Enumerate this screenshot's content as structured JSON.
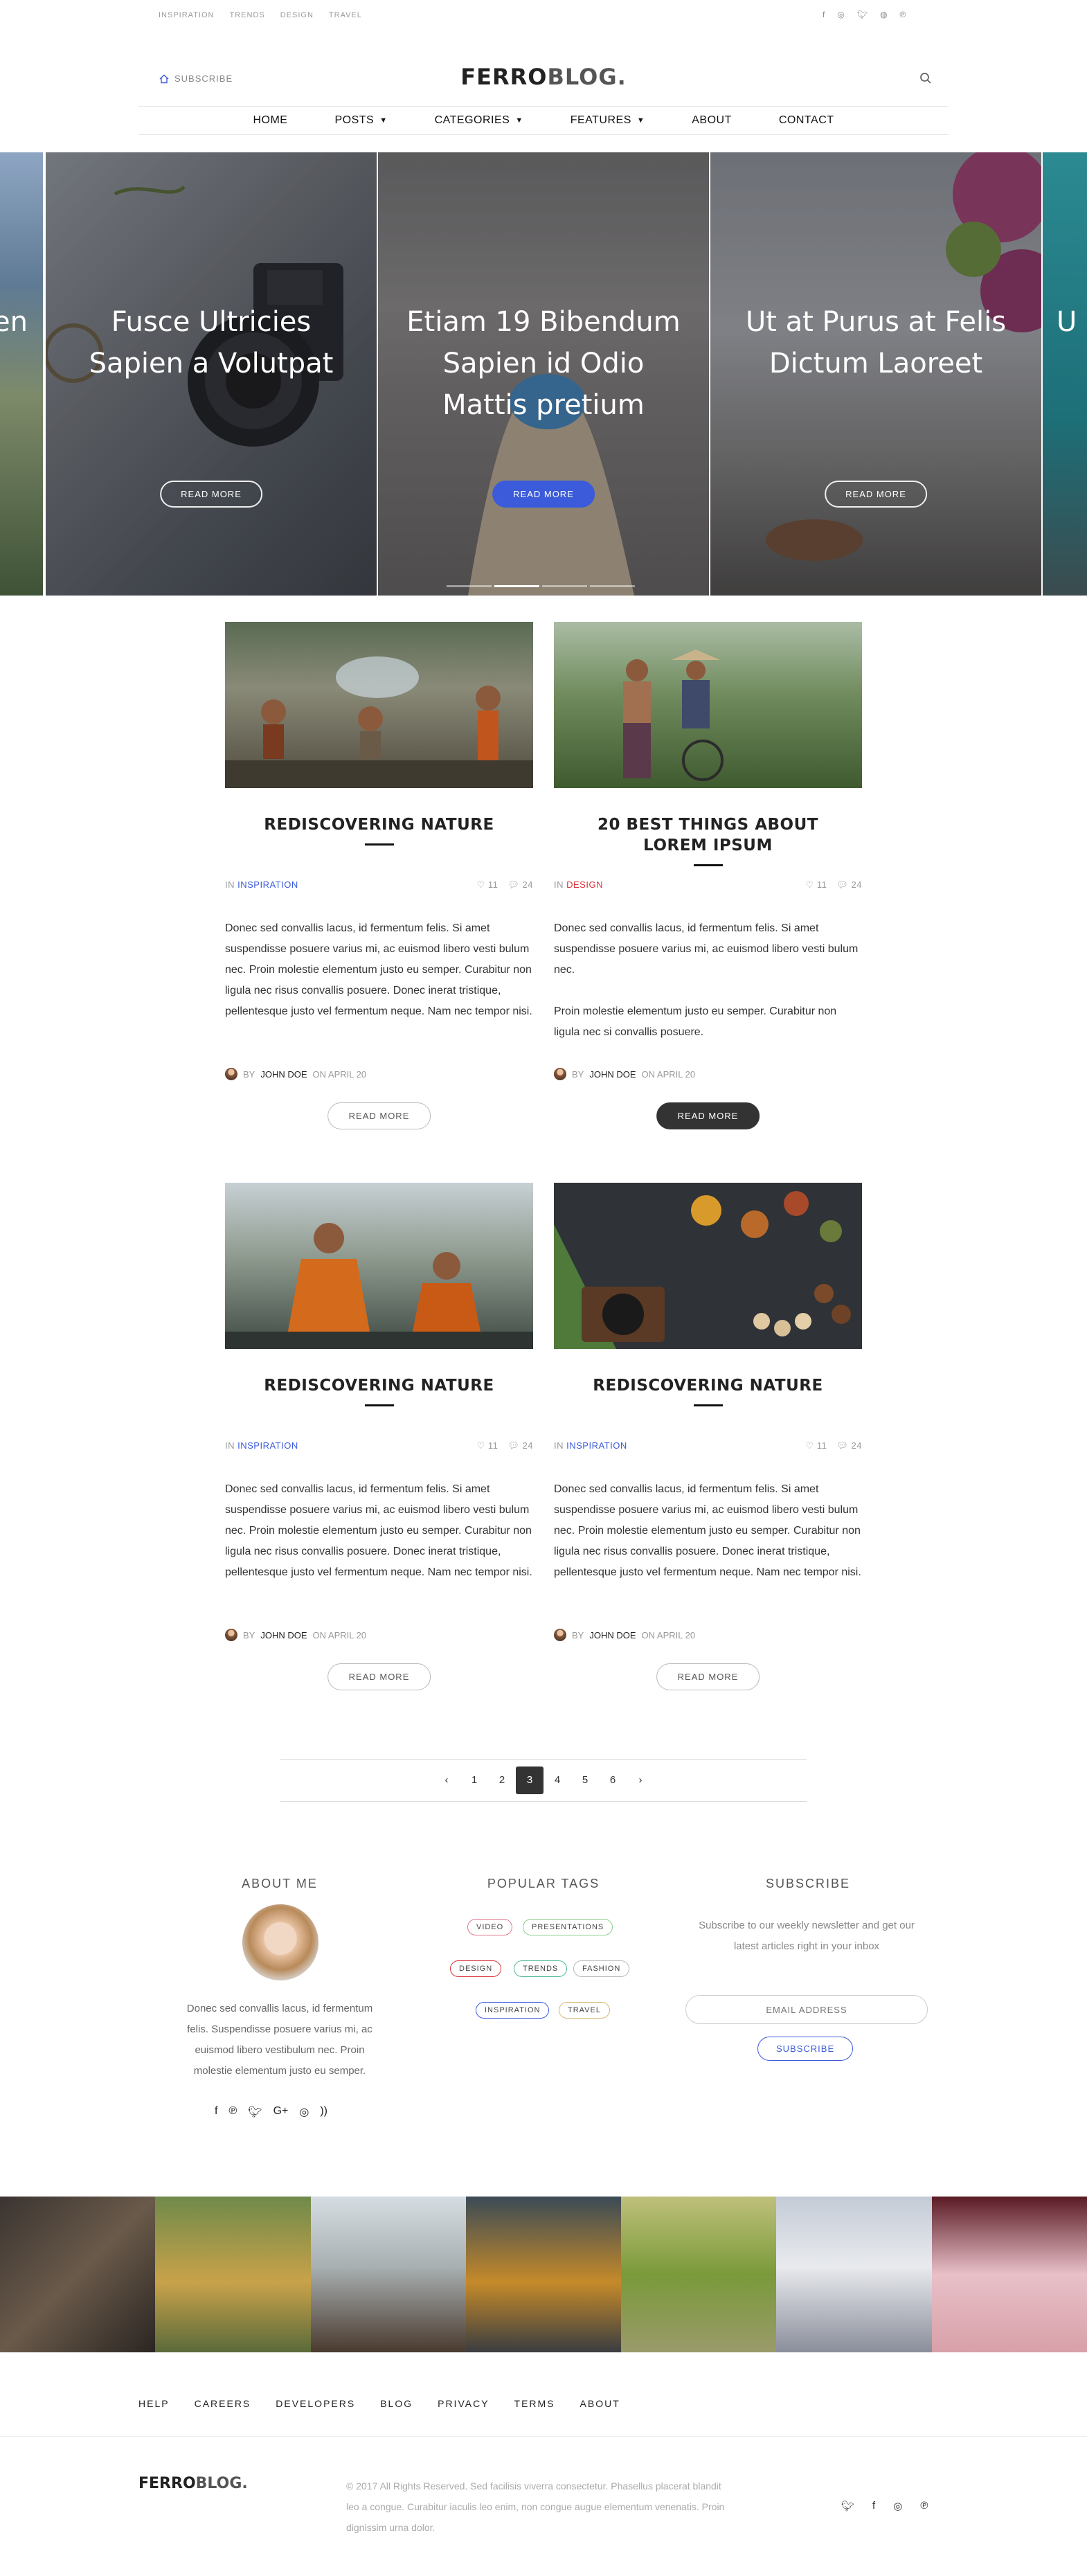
{
  "top_links": [
    "INSPIRATION",
    "TRENDS",
    "DESIGN",
    "TRAVEL"
  ],
  "social_icons": [
    "facebook-icon",
    "instagram-icon",
    "twitter-icon",
    "dribbble-icon",
    "pinterest-icon"
  ],
  "header": {
    "subscribe": "SUBSCRIBE",
    "logo_a": "FERRO",
    "logo_b": "BLOG."
  },
  "nav": [
    "HOME",
    "POSTS",
    "CATEGORIES",
    "FEATURES",
    "ABOUT",
    "CONTACT"
  ],
  "slides": [
    {
      "title": "en",
      "button": ""
    },
    {
      "title": "Fusce Ultricies Sapien a Volutpat",
      "button": "READ MORE"
    },
    {
      "title": "Etiam 19 Bibendum Sapien id Odio Mattis pretium",
      "button": "READ MORE"
    },
    {
      "title": "Ut at Purus at Felis Dictum Laoreet",
      "button": "READ MORE"
    },
    {
      "title": "U",
      "button": ""
    }
  ],
  "posts": [
    {
      "title": "REDISCOVERING NATURE",
      "in": "IN",
      "category": "INSPIRATION",
      "likes": "11",
      "comments": "24",
      "excerpt": "Donec sed convallis lacus, id fermentum felis. Si amet suspendisse posuere varius mi, ac euismod libero vesti bulum nec. Proin molestie elementum justo eu semper. Curabitur non ligula nec risus convallis posuere. Donec inerat tristique, pellentesque justo vel fermentum neque. Nam nec tempor nisi.",
      "by": "BY",
      "author": "JOHN DOE",
      "date": "ON APRIL 20",
      "button": "READ MORE"
    },
    {
      "title": "20 BEST THINGS ABOUT LOREM IPSUM",
      "in": "IN",
      "category": "DESIGN",
      "likes": "11",
      "comments": "24",
      "excerpt": "Donec sed convallis lacus, id fermentum felis. Si amet suspendisse posuere varius mi, ac euismod libero vesti bulum nec.",
      "excerpt2": "Proin molestie elementum justo eu semper. Curabitur non ligula nec si convallis posuere.",
      "by": "BY",
      "author": "JOHN DOE",
      "date": "ON APRIL 20",
      "button": "READ MORE"
    },
    {
      "title": "REDISCOVERING NATURE",
      "in": "IN",
      "category": "INSPIRATION",
      "likes": "11",
      "comments": "24",
      "excerpt": "Donec sed convallis lacus, id fermentum felis. Si amet suspendisse posuere varius mi, ac euismod libero vesti bulum nec. Proin molestie elementum justo eu semper. Curabitur non ligula nec risus convallis posuere. Donec inerat tristique, pellentesque justo vel fermentum neque. Nam nec tempor nisi.",
      "by": "BY",
      "author": "JOHN DOE",
      "date": "ON APRIL 20",
      "button": "READ MORE"
    },
    {
      "title": "REDISCOVERING NATURE",
      "in": "IN",
      "category": "INSPIRATION",
      "likes": "11",
      "comments": "24",
      "excerpt": "Donec sed convallis lacus, id fermentum felis. Si amet suspendisse posuere varius mi, ac euismod libero vesti bulum nec. Proin molestie elementum justo eu semper. Curabitur non ligula nec risus convallis posuere. Donec inerat tristique, pellentesque justo vel fermentum neque. Nam nec tempor nisi.",
      "by": "BY",
      "author": "JOHN DOE",
      "date": "ON APRIL 20",
      "button": "READ MORE"
    }
  ],
  "pagination": {
    "pages": [
      "1",
      "2",
      "3",
      "4",
      "5",
      "6"
    ],
    "current": "3"
  },
  "about": {
    "heading": "ABOUT ME",
    "text": "Donec sed convallis lacus, id fermentum felis. Suspendisse posuere varius mi, ac euismod libero vestibulum nec. Proin molestie elementum justo eu semper."
  },
  "tags": {
    "heading": "POPULAR TAGS",
    "items": [
      "VIDEO",
      "PRESENTATIONS",
      "DESIGN",
      "TRENDS",
      "FASHION",
      "INSPIRATION",
      "TRAVEL"
    ]
  },
  "subscribe": {
    "heading": "SUBSCRIBE",
    "text": "Subscribe to our weekly newsletter and get our latest articles right in your inbox",
    "placeholder": "EMAIL ADDRESS",
    "button": "SUBSCRIBE"
  },
  "footer": {
    "links": [
      "HELP",
      "CAREERS",
      "DEVELOPERS",
      "BLOG",
      "PRIVACY",
      "TERMS",
      "ABOUT"
    ],
    "logo_a": "FERRO",
    "logo_b": "BLOG.",
    "copyright": "© 2017 All Rights Reserved. Sed facilisis viverra consectetur. Phasellus placerat blandit leo a congue. Curabitur iaculis leo enim, non congue augue elementum venenatis. Proin dignissim urna dolor."
  },
  "colors": {
    "accent": "#3b5bdb",
    "design_tag": "#d9343a",
    "dark": "#333333"
  }
}
